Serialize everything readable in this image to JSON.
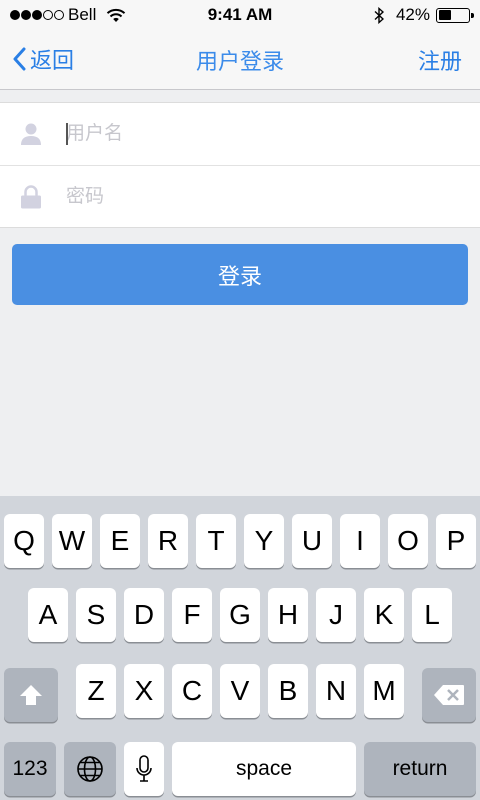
{
  "status_bar": {
    "carrier": "Bell",
    "time": "9:41 AM",
    "battery": "42%",
    "battery_level": 0.42
  },
  "nav": {
    "back_label": "返回",
    "title": "用户登录",
    "register_label": "注册"
  },
  "form": {
    "username_placeholder": "用户名",
    "password_placeholder": "密码"
  },
  "login_button": "登录",
  "keyboard": {
    "row1": [
      "Q",
      "W",
      "E",
      "R",
      "T",
      "Y",
      "U",
      "I",
      "O",
      "P"
    ],
    "row2": [
      "A",
      "S",
      "D",
      "F",
      "G",
      "H",
      "J",
      "K",
      "L"
    ],
    "row3": [
      "Z",
      "X",
      "C",
      "V",
      "B",
      "N",
      "M"
    ],
    "numbers_key": "123",
    "space_key": "space",
    "return_key": "return"
  }
}
